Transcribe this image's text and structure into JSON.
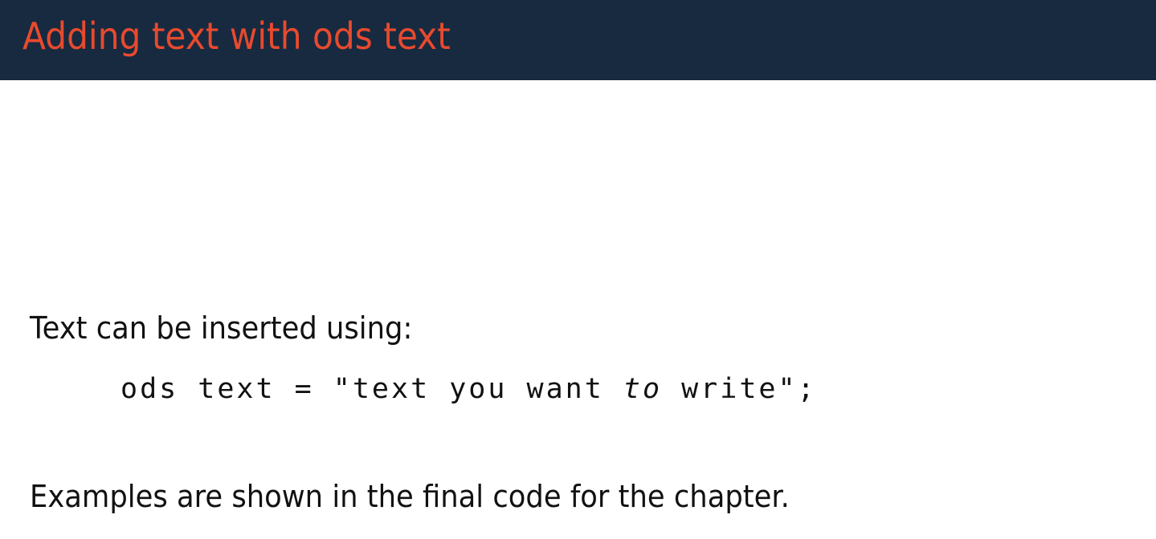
{
  "slide": {
    "title": "Adding text with ods text",
    "intro_text": "Text can be inserted using:",
    "code_line": {
      "before_keyword": "ods text = \"text you want ",
      "keyword": "to",
      "after_keyword": " write\";"
    },
    "outro_text": "Examples are shown in the final code for the chapter."
  },
  "colors": {
    "header_background": "#172a40",
    "title_text": "#e84a2e",
    "body_text": "#111111",
    "page_background": "#ffffff"
  }
}
